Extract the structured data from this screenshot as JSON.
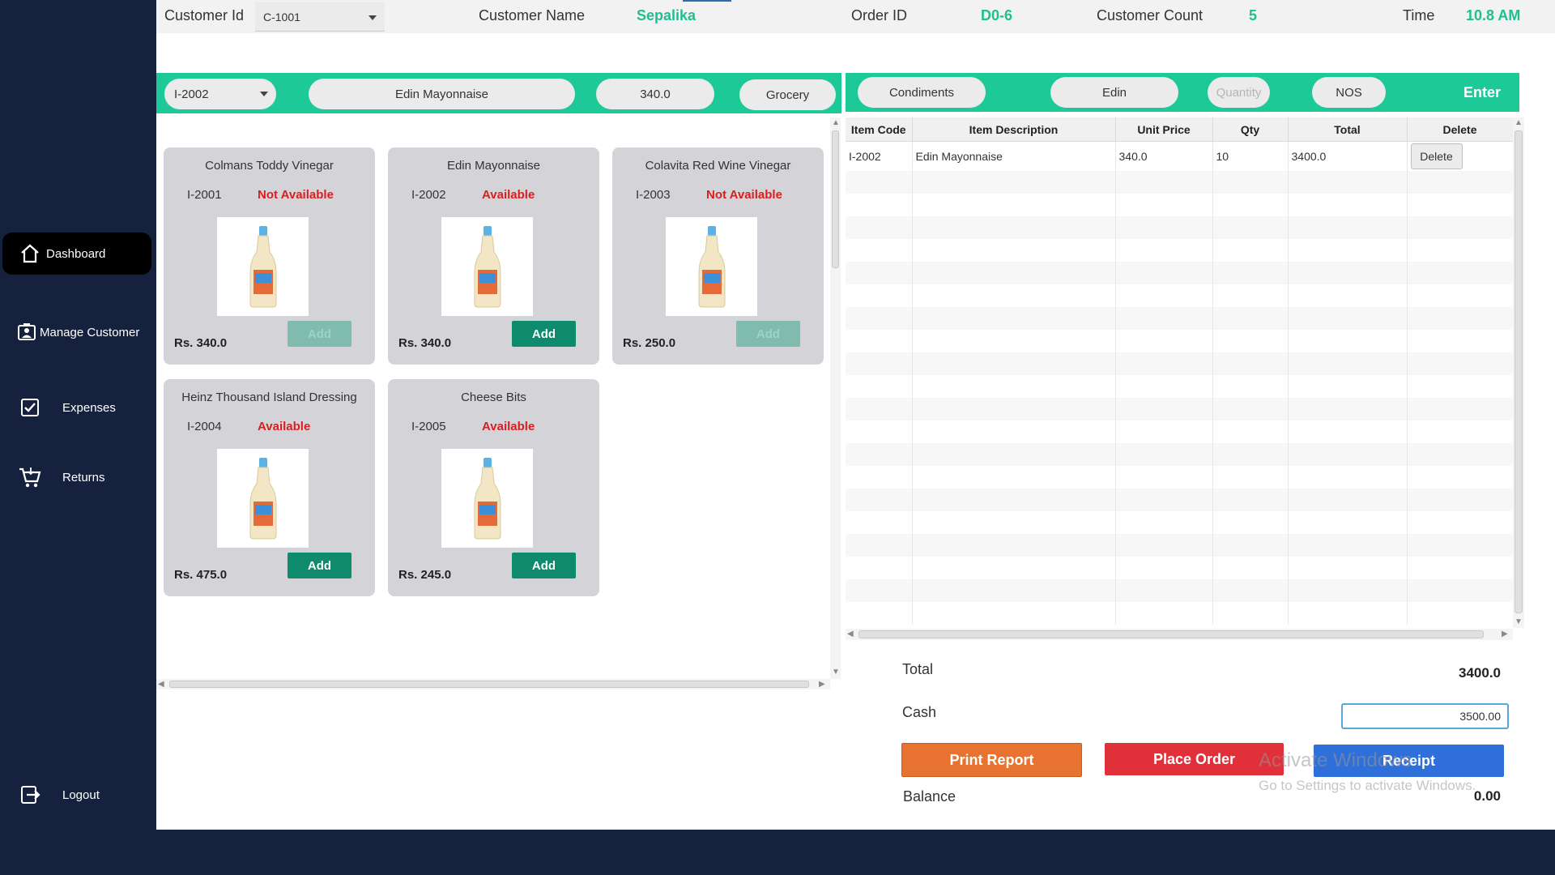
{
  "sidebar": {
    "items": [
      {
        "label": "Dashboard",
        "icon": "home-icon"
      },
      {
        "label": "Manage Customer",
        "icon": "user-icon"
      },
      {
        "label": "Expenses",
        "icon": "checkbox-icon"
      },
      {
        "label": "Returns",
        "icon": "cart-return-icon"
      },
      {
        "label": "Logout",
        "icon": "logout-icon"
      }
    ]
  },
  "header": {
    "customer_id_label": "Customer Id",
    "customer_id_value": "C-1001",
    "customer_name_label": "Customer Name",
    "customer_name_value": "Sepalika",
    "order_id_label": "Order ID",
    "order_id_value": "D0-6",
    "customer_count_label": "Customer Count",
    "customer_count_value": "5",
    "time_label": "Time",
    "time_value": "10.8 AM"
  },
  "item_entry": {
    "item_code": "I-2002",
    "item_description": "Edin Mayonnaise",
    "unit_price": "340.0",
    "category": "Grocery",
    "subcategory": "Condiments",
    "brand": "Edin",
    "quantity_placeholder": "Quantity",
    "unit": "NOS",
    "enter_label": "Enter"
  },
  "products": [
    {
      "name": "Colmans Toddy Vinegar",
      "code": "I-2001",
      "status": "Not Available",
      "price": "Rs.  340.0",
      "add_label": "Add",
      "enabled": false
    },
    {
      "name": "Edin Mayonnaise",
      "code": "I-2002",
      "status": "Available",
      "price": "Rs.  340.0",
      "add_label": "Add",
      "enabled": true
    },
    {
      "name": "Colavita Red Wine Vinegar",
      "code": "I-2003",
      "status": "Not Available",
      "price": "Rs.  250.0",
      "add_label": "Add",
      "enabled": false
    },
    {
      "name": "Heinz Thousand Island Dressing",
      "code": "I-2004",
      "status": "Available",
      "price": "Rs.  475.0",
      "add_label": "Add",
      "enabled": true
    },
    {
      "name": "Cheese Bits",
      "code": "I-2005",
      "status": "Available",
      "price": "Rs.  245.0",
      "add_label": "Add",
      "enabled": true
    }
  ],
  "order_table": {
    "headers": [
      "Item Code",
      "Item Description",
      "Unit Price",
      "Qty",
      "Total",
      "Delete"
    ],
    "rows": [
      [
        "I-2002",
        "Edin Mayonnaise",
        "340.0",
        "10",
        "3400.0",
        "Delete"
      ]
    ]
  },
  "summary": {
    "total_label": "Total",
    "total_value": "3400.0",
    "cash_label": "Cash",
    "cash_value": "3500.00",
    "balance_label": "Balance",
    "balance_value": "0.00"
  },
  "actions": {
    "print_label": "Print Report",
    "place_label": "Place Order",
    "receipt_label": "Receipt"
  },
  "watermark": {
    "line1": "Activate Windows",
    "line2": "Go to Settings to activate Windows."
  },
  "colors": {
    "sidebar": "#16213e",
    "accent_green": "#1dc997",
    "add_button": "#0e8a6c",
    "status_red": "#d81f1f",
    "print_button": "#e87330",
    "place_button": "#e0313a",
    "receipt_button": "#2f6fd9"
  }
}
